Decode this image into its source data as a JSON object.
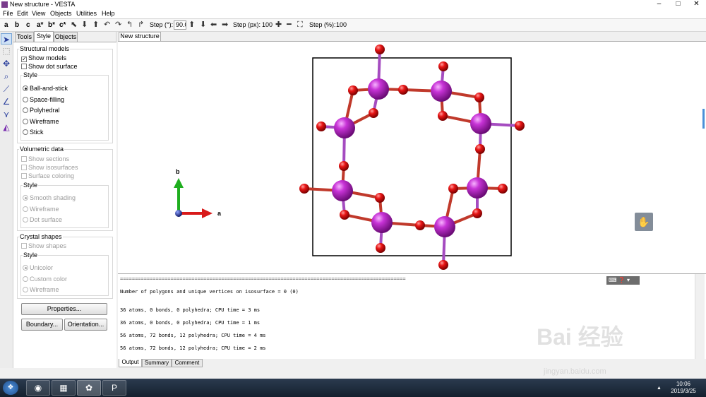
{
  "window": {
    "title": "New structure - VESTA",
    "minimize": "–",
    "maximize": "□",
    "close": "✕"
  },
  "menu": [
    "File",
    "Edit",
    "View",
    "Objects",
    "Utilities",
    "Help"
  ],
  "toolbar": {
    "axis_buttons": [
      "a",
      "b",
      "c",
      "a*",
      "b*",
      "c*"
    ],
    "step_deg_label": "Step (°):",
    "step_deg_value": "90.0",
    "step_px_label": "Step (px):",
    "step_px_value": "100",
    "step_pct_label": "Step (%):",
    "step_pct_value": "100"
  },
  "panel": {
    "tabs": [
      "Tools",
      "Style",
      "Objects"
    ],
    "active_tab": "Style",
    "structural_models": {
      "title": "Structural models",
      "show_models": {
        "label": "Show models",
        "checked": true
      },
      "show_dot_surface": {
        "label": "Show dot surface",
        "checked": false
      },
      "style_title": "Style",
      "styles": [
        "Ball-and-stick",
        "Space-filling",
        "Polyhedral",
        "Wireframe",
        "Stick"
      ],
      "selected_style": "Ball-and-stick"
    },
    "volumetric_data": {
      "title": "Volumetric data",
      "options": [
        "Show sections",
        "Show isosurfaces",
        "Surface coloring"
      ],
      "style_title": "Style",
      "styles": [
        "Smooth shading",
        "Wireframe",
        "Dot surface"
      ],
      "selected_style": "Smooth shading"
    },
    "crystal_shapes": {
      "title": "Crystal shapes",
      "show_shapes": "Show shapes",
      "style_title": "Style",
      "styles": [
        "Unicolor",
        "Custom color",
        "Wireframe"
      ],
      "selected_style": "Unicolor"
    },
    "buttons": {
      "properties": "Properties...",
      "boundary": "Boundary...",
      "orientation": "Orientation..."
    }
  },
  "viewer": {
    "tab": "New structure",
    "axis_labels": {
      "a": "a",
      "b": "b"
    }
  },
  "output": {
    "separator": "================================================================================================",
    "lines": [
      "Number of polygons and unique vertices on isosurface = 0 (0)",
      "36 atoms, 0 bonds, 0 polyhedra; CPU time = 3 ms",
      "36 atoms, 0 bonds, 0 polyhedra; CPU time = 1 ms",
      "56 atoms, 72 bonds, 12 polyhedra; CPU time = 4 ms",
      "56 atoms, 72 bonds, 12 polyhedra; CPU time = 2 ms"
    ],
    "tabs": [
      "Output",
      "Summary",
      "Comment"
    ],
    "active_tab": "Output"
  },
  "taskbar": {
    "time": "10:06",
    "date": "2019/3/25",
    "task_icons": [
      "chrome-icon",
      "network-icon",
      "vesta-icon",
      "powerpoint-icon"
    ]
  },
  "watermark": {
    "brand": "Bai 经验",
    "url": "jingyan.baidu.com"
  },
  "colors": {
    "atom_large": "#b41fbf",
    "atom_small": "#e00f0f",
    "bond_purple": "#a54cc0",
    "axis_a": "#d81a1a",
    "axis_b": "#1fae1f",
    "origin": "#1c2a8a"
  }
}
